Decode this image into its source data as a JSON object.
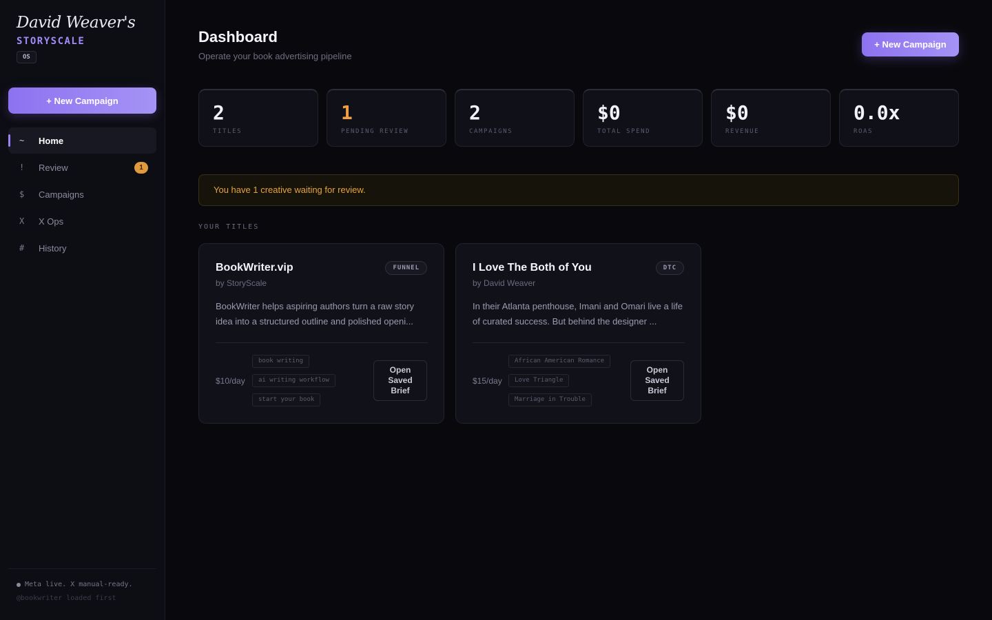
{
  "brand": {
    "script": "David Weaver's",
    "name": "STORYSCALE",
    "badge": "OS"
  },
  "sidebar": {
    "new_campaign_label": "+ New Campaign",
    "items": [
      {
        "icon": "~",
        "label": "Home",
        "active": true
      },
      {
        "icon": "!",
        "label": "Review",
        "badge": "1"
      },
      {
        "icon": "$",
        "label": "Campaigns"
      },
      {
        "icon": "X",
        "label": "X Ops"
      },
      {
        "icon": "#",
        "label": "History"
      }
    ],
    "footer": {
      "status": "Meta live. X manual-ready.",
      "sub": "@bookwriter loaded first"
    }
  },
  "header": {
    "title": "Dashboard",
    "subtitle": "Operate your book advertising pipeline",
    "new_campaign_label": "+ New Campaign"
  },
  "stats": [
    {
      "value": "2",
      "label": "TITLES"
    },
    {
      "value": "1",
      "label": "PENDING REVIEW",
      "highlight": "#f0a042"
    },
    {
      "value": "2",
      "label": "CAMPAIGNS"
    },
    {
      "value": "$0",
      "label": "TOTAL SPEND"
    },
    {
      "value": "$0",
      "label": "REVENUE"
    },
    {
      "value": "0.0x",
      "label": "ROAS"
    }
  ],
  "alert": {
    "text": "You have 1 creative waiting for review."
  },
  "section_label": "YOUR TITLES",
  "titles": [
    {
      "title": "BookWriter.vip",
      "tag": "FUNNEL",
      "author": "by StoryScale",
      "description": "BookWriter helps aspiring authors turn a raw story idea into a structured outline and polished openi...",
      "budget": "$10/day",
      "keywords": [
        "book writing",
        "ai writing workflow",
        "start your book"
      ],
      "action": "Open Saved Brief"
    },
    {
      "title": "I Love The Both of You",
      "tag": "DTC",
      "author": "by David Weaver",
      "description": "In their Atlanta penthouse, Imani and Omari live a life of curated success. But behind the designer ...",
      "budget": "$15/day",
      "keywords": [
        "African American Romance",
        "Love Triangle",
        "Marriage in Trouble"
      ],
      "action": "Open Saved Brief"
    }
  ],
  "colors": {
    "accent": "#9b82f5",
    "warning": "#f0a042",
    "background": "#09090d"
  }
}
